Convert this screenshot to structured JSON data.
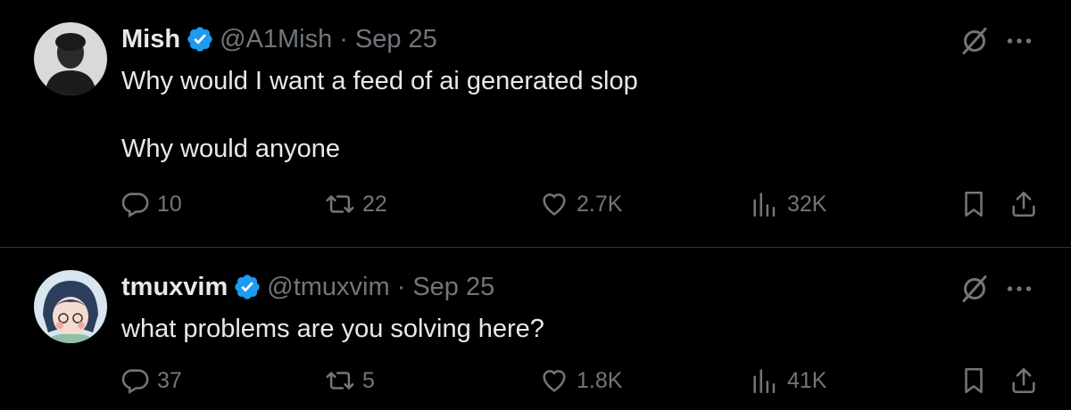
{
  "tweets": [
    {
      "name": "Mish",
      "handle": "@A1Mish",
      "dot": "·",
      "date": "Sep 25",
      "text": "Why would I want a feed of ai generated slop\n\nWhy would anyone",
      "stats": {
        "replies": "10",
        "retweets": "22",
        "likes": "2.7K",
        "views": "32K"
      }
    },
    {
      "name": "tmuxvim",
      "handle": "@tmuxvim",
      "dot": "·",
      "date": "Sep 25",
      "text": "what problems are you solving here?",
      "stats": {
        "replies": "37",
        "retweets": "5",
        "likes": "1.8K",
        "views": "41K"
      }
    }
  ],
  "colors": {
    "background": "#000000",
    "text": "#e7e9ea",
    "muted": "#71767b",
    "verified": "#1d9bf0",
    "divider": "#2f3336"
  },
  "icons": [
    "verified-badge-icon",
    "grok-icon",
    "more-icon",
    "reply-icon",
    "retweet-icon",
    "like-icon",
    "views-icon",
    "bookmark-icon",
    "share-icon"
  ]
}
